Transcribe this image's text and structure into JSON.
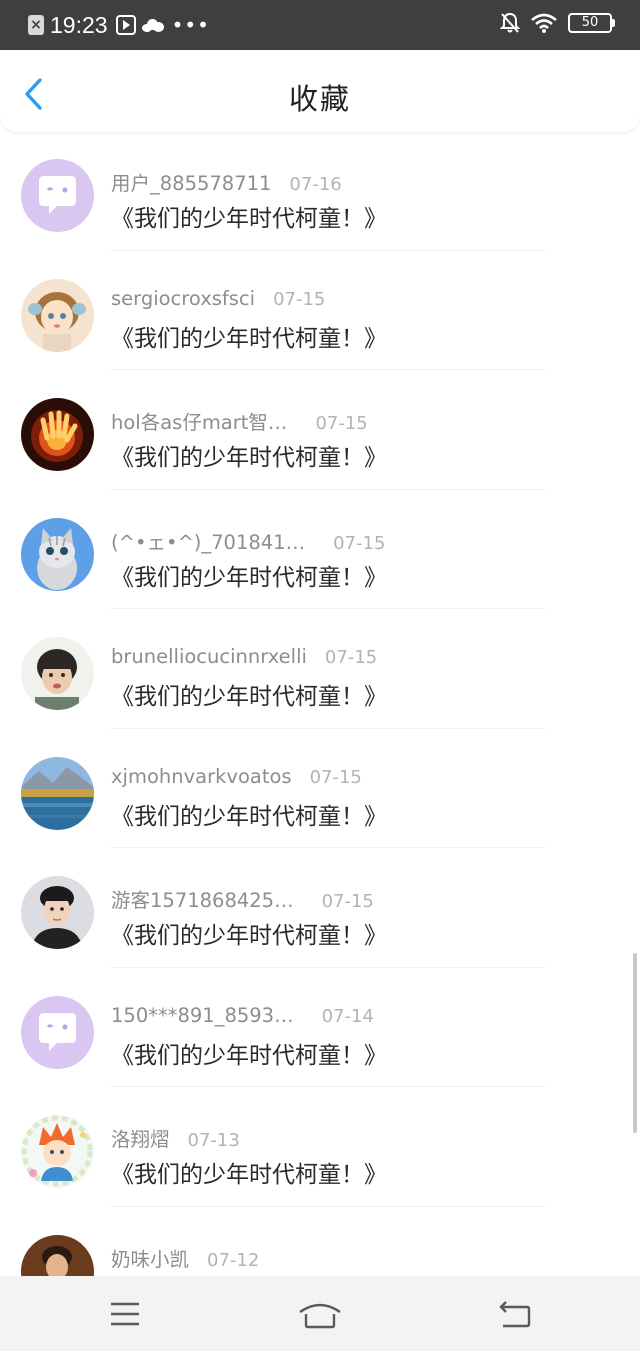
{
  "status_bar": {
    "time": "19:23",
    "battery": "50",
    "left_icons": [
      "close-notification-icon",
      "video-icon",
      "cloud-icon",
      "more-dots-icon"
    ],
    "right_icons": [
      "mute-bell-icon",
      "wifi-icon",
      "battery-icon"
    ]
  },
  "header": {
    "title": "收藏",
    "back_icon": "chevron-left-icon",
    "accent": "#2a9cf2"
  },
  "favorites": [
    {
      "user": "用户_885578711",
      "date": "07-16",
      "title": "《我们的少年时代柯童！》",
      "avatar": "default-chat"
    },
    {
      "user": "sergiocroxsfsci",
      "date": "07-15",
      "title": "《我们的少年时代柯童！》",
      "avatar": "doll"
    },
    {
      "user": "hol各as仔mart智…",
      "date": "07-15",
      "title": "《我们的少年时代柯童！》",
      "avatar": "fire-hand"
    },
    {
      "user": "(^•ェ•^)_701841…",
      "date": "07-15",
      "title": "《我们的少年时代柯童！》",
      "avatar": "kitten"
    },
    {
      "user": "brunelliocucinnrxelli",
      "date": "07-15",
      "title": "《我们的少年时代柯童！》",
      "avatar": "child-photo"
    },
    {
      "user": "xjmohnvarkvoatos",
      "date": "07-15",
      "title": "《我们的少年时代柯童！》",
      "avatar": "lake-landscape"
    },
    {
      "user": "游客1571868425…",
      "date": "07-15",
      "title": "《我们的少年时代柯童！》",
      "avatar": "young-man"
    },
    {
      "user": "150***891_8593…",
      "date": "07-14",
      "title": "《我们的少年时代柯童！》",
      "avatar": "default-chat"
    },
    {
      "user": "洛翔熠",
      "date": "07-13",
      "title": "《我们的少年时代柯童！》",
      "avatar": "cartoon-boy"
    },
    {
      "user": "奶味小凯",
      "date": "07-12",
      "title": "",
      "avatar": "portrait"
    }
  ],
  "nav_bar": {
    "menu_icon": "menu-icon",
    "home_icon": "home-icon",
    "back_icon": "back-icon"
  }
}
